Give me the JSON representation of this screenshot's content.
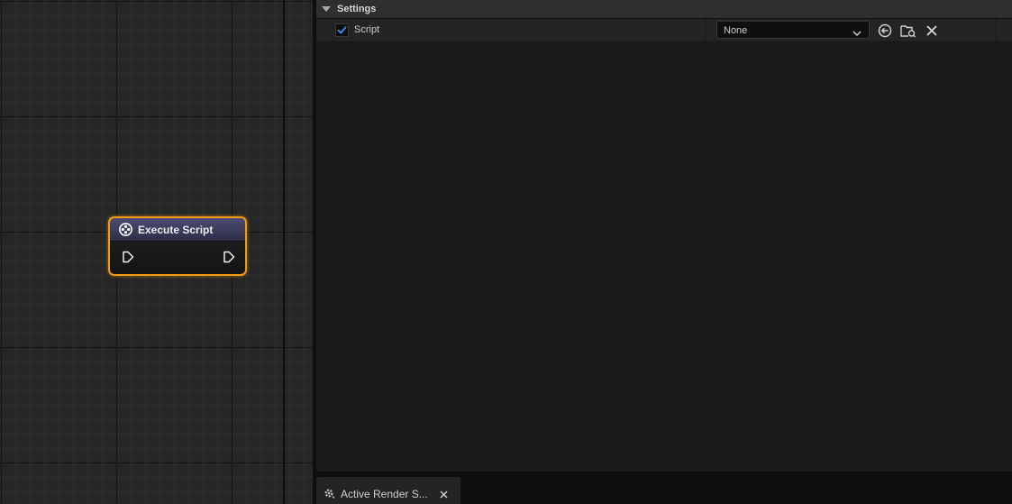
{
  "graph": {
    "node": {
      "title": "Execute Script",
      "icon": "movie-reel-icon",
      "pins": [
        "exec-input-pin",
        "exec-output-pin"
      ]
    }
  },
  "details": {
    "section": {
      "title": "Settings",
      "expanded": true
    },
    "property": {
      "label": "Script",
      "enabled": true,
      "value": "None",
      "buttons": [
        "use-selected-asset-icon",
        "browse-to-asset-icon",
        "clear-icon"
      ]
    }
  },
  "tabs": [
    {
      "label": "Active Render S...",
      "icon": "render-gear-icon",
      "closable": true
    }
  ],
  "colors": {
    "node_selection": "#f39c12",
    "node_header": "#4b4b74",
    "checkbox_check": "#3b8cf0",
    "panel_background": "#1b1b1b",
    "graph_background": "#262626"
  }
}
